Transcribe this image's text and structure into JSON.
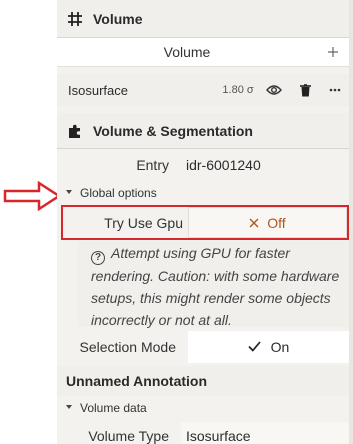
{
  "volume_section": {
    "title": "Volume",
    "add_row_label": "Volume",
    "item": {
      "name": "Isosurface",
      "value": "1.80 σ"
    }
  },
  "segmentation_section": {
    "title": "Volume & Segmentation",
    "entry_label": "Entry",
    "entry_value": "idr-6001240",
    "global_options_label": "Global options",
    "try_gpu_label": "Try Use Gpu",
    "try_gpu_value": "Off",
    "help_text": "Attempt using GPU for faster rendering. Caution: with some hardware setups, this might render some objects incorrectly or not at all.",
    "selection_mode_label": "Selection Mode",
    "selection_mode_value": "On"
  },
  "annotation_section": {
    "title": "Unnamed Annotation",
    "volume_data_label": "Volume data",
    "volume_type_label": "Volume Type",
    "volume_type_value": "Isosurface"
  },
  "colors": {
    "annotation_red": "#d7262c",
    "panel_bg": "#f3f2ee",
    "accent_orange": "#b0561c"
  }
}
